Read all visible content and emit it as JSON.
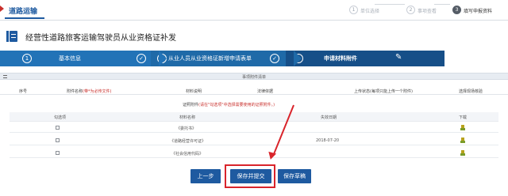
{
  "app": {
    "section_title": "道路运输"
  },
  "top_steps": [
    {
      "num": "1",
      "label": "单位选择",
      "active": false
    },
    {
      "num": "2",
      "label": "事项查看",
      "active": false
    },
    {
      "num": "3",
      "label": "填写申报资料",
      "active": true
    }
  ],
  "page": {
    "title": "经营性道路旅客运输驾驶员从业资格证补发"
  },
  "wizard": [
    {
      "num": "1",
      "label": "基本信息"
    },
    {
      "num": "2",
      "label": "从业人员从业资格证新增申请表单"
    },
    {
      "num": "3",
      "label": "申请材料附件"
    }
  ],
  "materials": {
    "title": "事项附件清单",
    "columns": {
      "seq": "序号",
      "name": "附件名称",
      "required_note": "(带*为必传文件)",
      "desc": "材料说明",
      "basis": "法律依据",
      "upload": "上传状态(每项只能上传一个附件)",
      "select": "选择现场核验"
    }
  },
  "certificates": {
    "title": "证照附件",
    "note": "(请在\"勾选项\"中选择需要使用的证照附件。)",
    "columns": {
      "check": "勾选项",
      "name": "材料名称",
      "expiry": "失效日期",
      "download": "下载"
    },
    "rows": [
      {
        "name": "《委托书》",
        "expiry": ""
      },
      {
        "name": "《道路经营许可证》",
        "expiry": "2018-07-20"
      },
      {
        "name": "《社会信用代码》",
        "expiry": ""
      }
    ]
  },
  "buttons": {
    "prev": "上一步",
    "save_submit": "保存并提交",
    "save_draft": "保存草稿"
  },
  "colors": {
    "primary": "#1e5aa0",
    "highlight": "#d9242b"
  }
}
